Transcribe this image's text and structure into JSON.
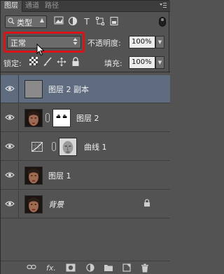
{
  "tabs": [
    {
      "label": "图层",
      "active": true
    },
    {
      "label": "通道",
      "active": false
    },
    {
      "label": "路径",
      "active": false
    }
  ],
  "filter": {
    "kind_label": "类型",
    "icons": [
      "image-filter-icon",
      "adjustment-filter-icon",
      "text-filter-icon",
      "shape-filter-icon",
      "smart-object-filter-icon"
    ],
    "text_icon": "T"
  },
  "blend": {
    "mode": "正常",
    "opacity_label": "不透明度:",
    "opacity_value": "100%"
  },
  "lock": {
    "label": "锁定:",
    "fill_label": "填充:",
    "fill_value": "100%"
  },
  "layers": [
    {
      "name": "图层 2 副本",
      "selected": true,
      "thumb": "gray",
      "visible": true
    },
    {
      "name": "图层 2",
      "selected": false,
      "thumb": "face-with-mask",
      "visible": true
    },
    {
      "name": "曲线 1",
      "selected": false,
      "thumb": "curves-adjustment",
      "visible": true
    },
    {
      "name": "图层 1",
      "selected": false,
      "thumb": "face",
      "visible": true
    },
    {
      "name": "背景",
      "selected": false,
      "thumb": "face",
      "visible": true,
      "locked": true,
      "italic": true
    }
  ],
  "bottom_icons": [
    "link-layers-icon",
    "fx-icon",
    "add-mask-icon",
    "adjustment-layer-icon",
    "new-group-icon",
    "new-layer-icon",
    "delete-layer-icon"
  ],
  "bottom_fx_text": "fx.",
  "colors": {
    "panel": "#535353",
    "selected_row": "#5f6c80",
    "highlight_box": "#d8141a"
  }
}
